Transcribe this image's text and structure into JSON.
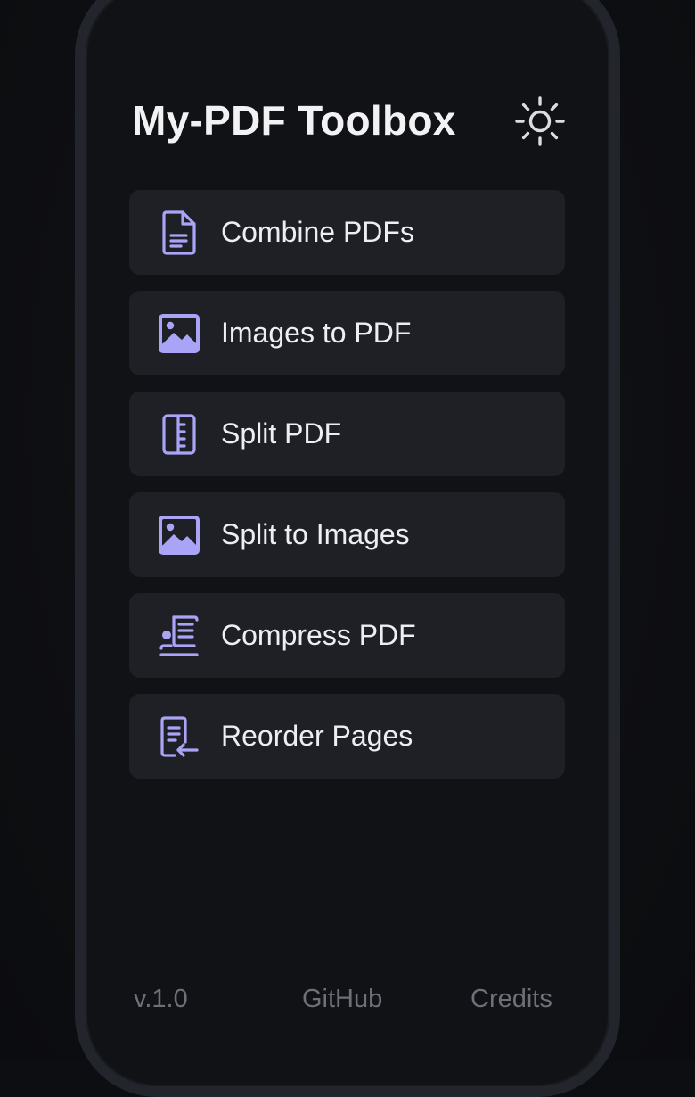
{
  "app": {
    "title": "My-PDF Toolbox",
    "theme_icon": "sun-icon",
    "accent_color": "#a9a4f5"
  },
  "menu": {
    "items": [
      {
        "label": "Combine PDFs",
        "icon": "document-icon"
      },
      {
        "label": "Images to PDF",
        "icon": "image-icon"
      },
      {
        "label": "Split PDF",
        "icon": "split-icon"
      },
      {
        "label": "Split to Images",
        "icon": "image-icon"
      },
      {
        "label": "Compress PDF",
        "icon": "compress-icon"
      },
      {
        "label": "Reorder Pages",
        "icon": "reorder-icon"
      }
    ]
  },
  "footer": {
    "version": "v.1.0",
    "github": "GitHub",
    "credits": "Credits"
  }
}
